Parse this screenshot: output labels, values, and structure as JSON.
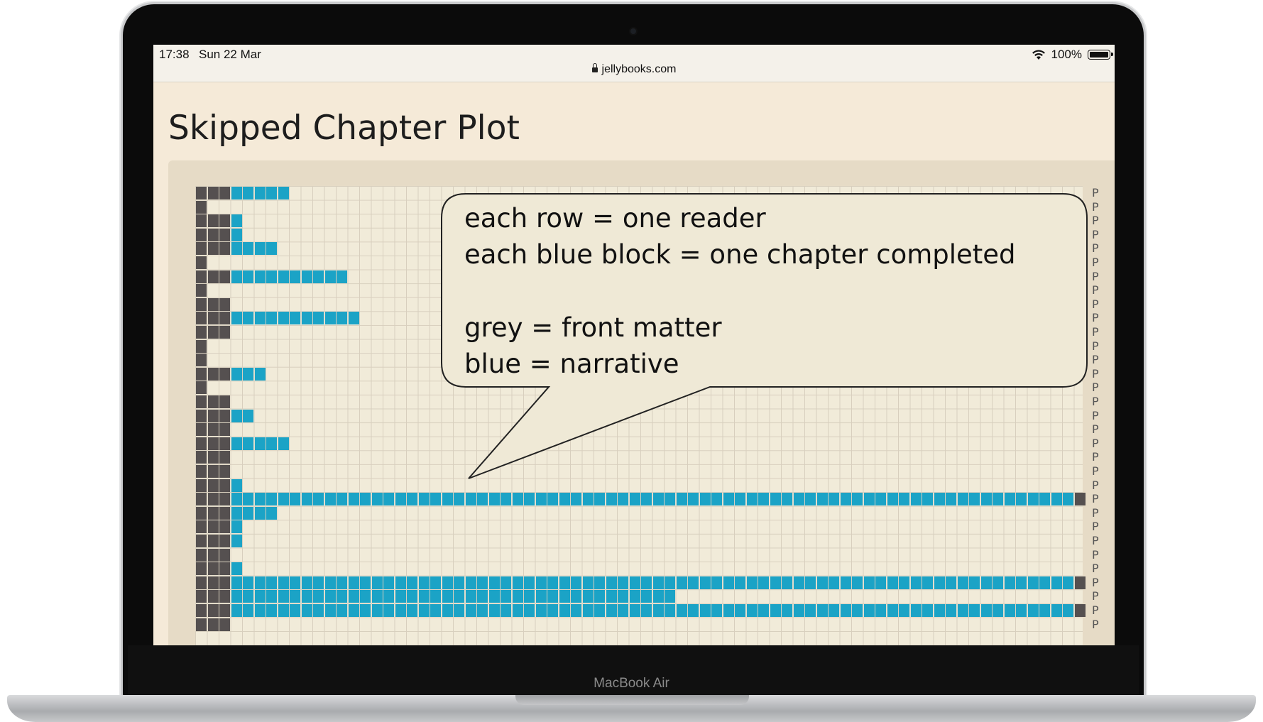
{
  "status_bar": {
    "time": "17:38",
    "date": "Sun 22 Mar",
    "url": "jellybooks.com",
    "battery": "100%",
    "icons": [
      "wifi-icon",
      "battery-icon",
      "lock-icon"
    ]
  },
  "page": {
    "title": "Skipped Chapter Plot"
  },
  "callout": {
    "lines": [
      "each row = one reader",
      "each blue block = one chapter completed",
      "grey = front matter",
      "blue = narrative"
    ]
  },
  "device": {
    "label": "MacBook Air"
  },
  "row_end_label": "P",
  "colors": {
    "front_matter": "#555050",
    "narrative": "#1ba3c6",
    "grid_bg": "#f1ebd9"
  },
  "chart_data": {
    "type": "heatmap",
    "title": "Skipped Chapter Plot",
    "legend": [
      "grey = front matter",
      "blue = narrative"
    ],
    "rows": [
      {
        "grey": 3,
        "blue": 5
      },
      {
        "grey": 1,
        "blue": 0
      },
      {
        "grey": 3,
        "blue": 1
      },
      {
        "grey": 3,
        "blue": 1
      },
      {
        "grey": 3,
        "blue": 4
      },
      {
        "grey": 1,
        "blue": 0
      },
      {
        "grey": 3,
        "blue": 10
      },
      {
        "grey": 1,
        "blue": 0
      },
      {
        "grey": 3,
        "blue": 0
      },
      {
        "grey": 3,
        "blue": 11
      },
      {
        "grey": 3,
        "blue": 0
      },
      {
        "grey": 1,
        "blue": 0
      },
      {
        "grey": 1,
        "blue": 0
      },
      {
        "grey": 3,
        "blue": 3
      },
      {
        "grey": 1,
        "blue": 0
      },
      {
        "grey": 3,
        "blue": 0
      },
      {
        "grey": 3,
        "blue": 2
      },
      {
        "grey": 3,
        "blue": 0
      },
      {
        "grey": 3,
        "blue": 5
      },
      {
        "grey": 3,
        "blue": 0
      },
      {
        "grey": 3,
        "blue": 0
      },
      {
        "grey": 3,
        "blue": 1
      },
      {
        "grey": 3,
        "blue": 72,
        "grey_end": 1
      },
      {
        "grey": 3,
        "blue": 4
      },
      {
        "grey": 3,
        "blue": 1
      },
      {
        "grey": 3,
        "blue": 1
      },
      {
        "grey": 3,
        "blue": 0
      },
      {
        "grey": 3,
        "blue": 1
      },
      {
        "grey": 3,
        "blue": 72,
        "grey_end": 1
      },
      {
        "grey": 3,
        "blue": 38
      },
      {
        "grey": 3,
        "blue": 72,
        "grey_end": 1
      },
      {
        "grey": 3,
        "blue": 0
      }
    ]
  }
}
